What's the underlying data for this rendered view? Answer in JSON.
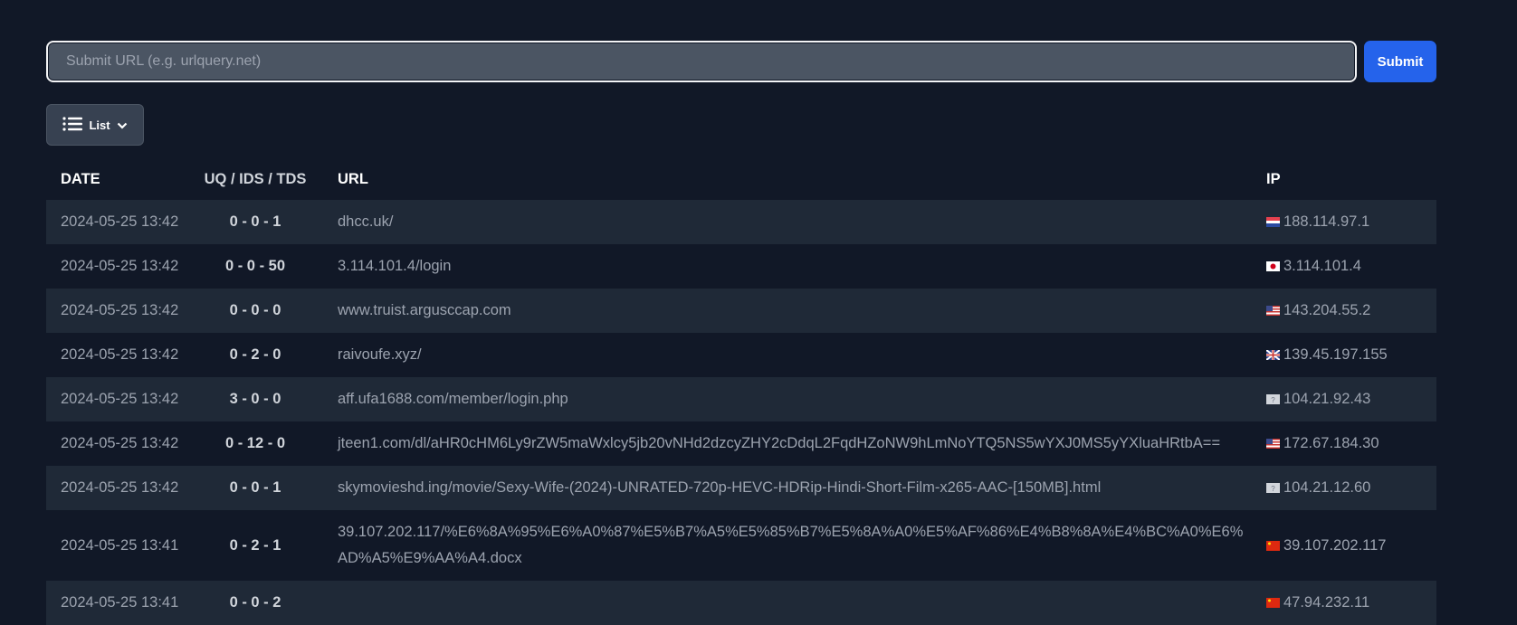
{
  "search": {
    "placeholder": "Submit URL (e.g. urlquery.net)",
    "submit_label": "Submit"
  },
  "view": {
    "label": "List"
  },
  "table": {
    "headers": {
      "date": "DATE",
      "score": "UQ / IDS / TDS",
      "url": "URL",
      "ip": "IP"
    },
    "rows": [
      {
        "date": "2024-05-25 13:42",
        "score": "0 - 0 - 1",
        "url": "dhcc.uk/",
        "ip": "188.114.97.1",
        "flag": "nl"
      },
      {
        "date": "2024-05-25 13:42",
        "score": "0 - 0 - 50",
        "url": "3.114.101.4/login",
        "ip": "3.114.101.4",
        "flag": "jp"
      },
      {
        "date": "2024-05-25 13:42",
        "score": "0 - 0 - 0",
        "url": "www.truist.argusccap.com",
        "ip": "143.204.55.2",
        "flag": "us"
      },
      {
        "date": "2024-05-25 13:42",
        "score": "0 - 2 - 0",
        "url": "raivoufe.xyz/",
        "ip": "139.45.197.155",
        "flag": "gb"
      },
      {
        "date": "2024-05-25 13:42",
        "score": "3 - 0 - 0",
        "url": "aff.ufa1688.com/member/login.php",
        "ip": "104.21.92.43",
        "flag": "unknown"
      },
      {
        "date": "2024-05-25 13:42",
        "score": "0 - 12 - 0",
        "url": "jteen1.com/dl/aHR0cHM6Ly9rZW5maWxlcy5jb20vNHd2dzcyZHY2cDdqL2FqdHZoNW9hLmNoYTQ5NS5wYXJ0MS5yYXluaHRtbA==",
        "ip": "172.67.184.30",
        "flag": "us"
      },
      {
        "date": "2024-05-25 13:42",
        "score": "0 - 0 - 1",
        "url": "skymovieshd.ing/movie/Sexy-Wife-(2024)-UNRATED-720p-HEVC-HDRip-Hindi-Short-Film-x265-AAC-[150MB].html",
        "ip": "104.21.12.60",
        "flag": "unknown"
      },
      {
        "date": "2024-05-25 13:41",
        "score": "0 - 2 - 1",
        "url": "39.107.202.117/%E6%8A%95%E6%A0%87%E5%B7%A5%E5%85%B7%E5%8A%A0%E5%AF%86%E4%B8%8A%E4%BC%A0%E6%AD%A5%E9%AA%A4.docx",
        "ip": "39.107.202.117",
        "flag": "cn"
      },
      {
        "date": "2024-05-25 13:41",
        "score": "0 - 0 - 2",
        "url": "",
        "ip": "47.94.232.11",
        "flag": "cn"
      }
    ]
  }
}
